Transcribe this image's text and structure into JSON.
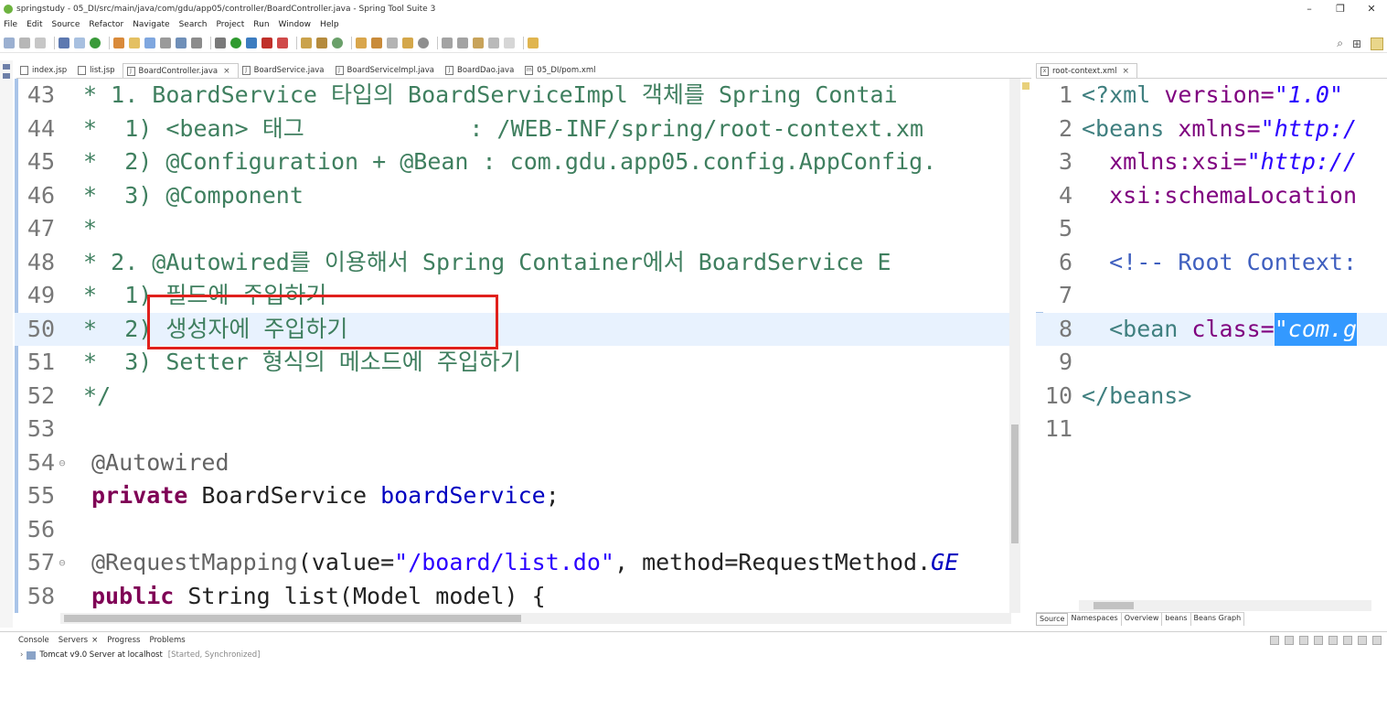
{
  "window": {
    "title": "springstudy - 05_DI/src/main/java/com/gdu/app05/controller/BoardController.java - Spring Tool Suite 3",
    "controls": [
      "–",
      "❐",
      "✕"
    ]
  },
  "menu": [
    "File",
    "Edit",
    "Source",
    "Refactor",
    "Navigate",
    "Search",
    "Project",
    "Run",
    "Window",
    "Help"
  ],
  "editor_tabs": [
    {
      "label": "index.jsp",
      "icon": "jsp-file-icon",
      "active": false
    },
    {
      "label": "list.jsp",
      "icon": "jsp-file-icon",
      "active": false
    },
    {
      "label": "BoardController.java",
      "icon": "java-file-icon",
      "active": true
    },
    {
      "label": "BoardService.java",
      "icon": "java-file-icon",
      "active": false
    },
    {
      "label": "BoardServiceImpl.java",
      "icon": "java-file-icon",
      "active": false
    },
    {
      "label": "BoardDao.java",
      "icon": "java-file-icon",
      "active": false
    },
    {
      "label": "05_DI/pom.xml",
      "icon": "xml-file-icon",
      "active": false
    }
  ],
  "java_lines": [
    {
      "n": "43",
      "text": " * 1. BoardService 타입의 BoardServiceImpl 객체를 Spring Contai"
    },
    {
      "n": "44",
      "text": " *  1) <bean> 태그            : /WEB-INF/spring/root-context.xm"
    },
    {
      "n": "45",
      "text": " *  2) @Configuration + @Bean : com.gdu.app05.config.AppConfig."
    },
    {
      "n": "46",
      "text": " *  3) @Component"
    },
    {
      "n": "47",
      "text": " *"
    },
    {
      "n": "48",
      "text": " * 2. @Autowired를 이용해서 Spring Container에서 BoardService E"
    },
    {
      "n": "49",
      "text": " *  1) 필드에 주입하기"
    },
    {
      "n": "50",
      "text": " *  2) 생성자에 주입하기"
    },
    {
      "n": "51",
      "text": " *  3) Setter 형식의 메소드에 주입하기"
    },
    {
      "n": "52",
      "text": " */"
    },
    {
      "n": "53",
      "text": ""
    },
    {
      "n": "54",
      "text": "@Autowired"
    },
    {
      "n": "55",
      "kw": "private",
      "rest": " BoardService ",
      "field": "boardService",
      "tail": ";"
    },
    {
      "n": "56",
      "text": ""
    },
    {
      "n": "57",
      "ann": "@RequestMapping",
      "p1": "(value=",
      "str": "\"/board/list.do\"",
      "p2": ", method=RequestMethod.",
      "ital": "GE"
    },
    {
      "n": "58",
      "kw": "public",
      "rest": " String list(Model model) {"
    }
  ],
  "xml_tab": {
    "label": "root-context.xml",
    "icon": "xml-file-icon"
  },
  "xml_lines": [
    {
      "n": "1",
      "a": "<?xml ",
      "b": "version=",
      "c": "\"1.0\""
    },
    {
      "n": "2",
      "a": "<beans ",
      "b": "xmlns=",
      "c": "\"http:/"
    },
    {
      "n": "3",
      "a": "  ",
      "b": "xmlns:xsi=",
      "c": "\"http://"
    },
    {
      "n": "4",
      "a": "  ",
      "b": "xsi:schemaLocation",
      "c": ""
    },
    {
      "n": "5",
      "a": "",
      "b": "",
      "c": ""
    },
    {
      "n": "6",
      "a": "  <!-- Root Context:",
      "b": "",
      "c": ""
    },
    {
      "n": "7",
      "a": "",
      "b": "",
      "c": ""
    },
    {
      "n": "8",
      "a": "  <bean ",
      "b": "class=",
      "c": "\"com.g"
    },
    {
      "n": "9",
      "a": "",
      "b": "",
      "c": ""
    },
    {
      "n": "10",
      "a": "</beans>",
      "b": "",
      "c": ""
    },
    {
      "n": "11",
      "a": "",
      "b": "",
      "c": ""
    }
  ],
  "xml_bottom_tabs": [
    "Source",
    "Namespaces",
    "Overview",
    "beans",
    "Beans Graph"
  ],
  "console": {
    "tabs": [
      "Console",
      "Servers",
      "Progress",
      "Problems"
    ],
    "server": "Tomcat v9.0 Server at localhost",
    "status": "[Started, Synchronized]"
  }
}
